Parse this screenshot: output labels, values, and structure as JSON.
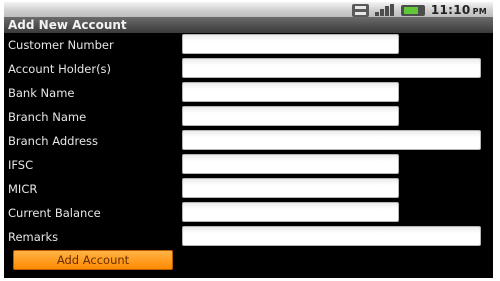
{
  "status_bar": {
    "time": "11:10",
    "ampm": "PM",
    "icons": [
      "notification-icon",
      "signal-icon",
      "battery-icon"
    ]
  },
  "title": "Add New Account",
  "form": {
    "fields": [
      {
        "label": "Customer Number",
        "value": "",
        "placeholder": ""
      },
      {
        "label": "Account Holder(s)",
        "value": "",
        "placeholder": ""
      },
      {
        "label": "Bank Name",
        "value": "",
        "placeholder": ""
      },
      {
        "label": "Branch Name",
        "value": "",
        "placeholder": ""
      },
      {
        "label": "Branch Address",
        "value": "",
        "placeholder": ""
      },
      {
        "label": "IFSC",
        "value": "",
        "placeholder": ""
      },
      {
        "label": "MICR",
        "value": "",
        "placeholder": ""
      },
      {
        "label": "Current Balance",
        "value": "",
        "placeholder": ""
      },
      {
        "label": "Remarks",
        "value": "",
        "placeholder": ""
      }
    ],
    "submit_label": "Add Account"
  },
  "colors": {
    "screen_background": "#000000",
    "title_bar": "#4a4a4a",
    "label_text": "#e6e6e6",
    "input_background": "#ffffff",
    "button_accent": "#ff9a1a"
  }
}
